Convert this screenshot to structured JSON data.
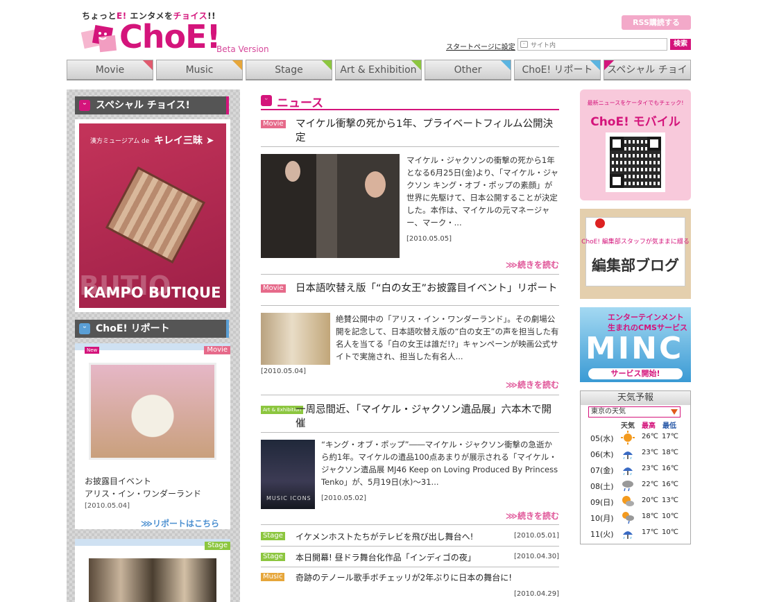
{
  "header": {
    "tagline_a": "ちょっと",
    "tagline_b": "E!",
    "tagline_c": " エンタメを",
    "tagline_d": "チョイス",
    "tagline_e": "!!",
    "logo": "ChoE!",
    "beta": "Beta Version",
    "rss_label": "RSS購読する",
    "startpage_link": "スタートページに設定",
    "search_placeholder": "サイト内",
    "search_button": "検索"
  },
  "nav": {
    "tabs": [
      {
        "label": "Movie",
        "color": "#e05a6e"
      },
      {
        "label": "Music",
        "color": "#e6a63a"
      },
      {
        "label": "Stage",
        "color": "#8cc63f"
      },
      {
        "label": "Art & Exhibition",
        "color": "#8cc63f"
      },
      {
        "label": "Other",
        "color": "#5ab4e0"
      },
      {
        "label": "ChoE! リポート",
        "color": "#5ab4e0"
      },
      {
        "label": "スペシャル チョイス!",
        "color": "#d4147b"
      }
    ]
  },
  "left": {
    "special_heading": "スペシャル チョイス!",
    "promo": {
      "subtitle": "漢方ミュージアム de",
      "title": "キレイ三昧 ➤",
      "bg_text": "BUTIQ",
      "name": "KAMPO BUTIQUE"
    },
    "report_heading": "ChoE! リポート",
    "report": {
      "tag_new": "New",
      "tag_category": "Movie",
      "line1": "お披露目イベント",
      "line2": "アリス・イン・ワンダーランド",
      "date": "[2010.05.04]",
      "link": "⋙リポートはこちら"
    },
    "stage_tag": "Stage"
  },
  "news": {
    "heading": "ニュース",
    "articles": [
      {
        "category": "Movie",
        "title": "マイケル衝撃の死から1年、プライベートフィルム公開決定",
        "body": "マイケル・ジャクソンの衝撃の死から1年となる6月25日(金)より、「マイケル・ジャクソン キング・オブ・ポップの素顔」が世界に先駆けて、日本公開することが決定した。本作は、マイケルの元マネージャー、マーク・...",
        "date": "[2010.05.05]",
        "more": "⋙続きを読む"
      },
      {
        "category": "Movie",
        "title": "日本語吹替え版「“白の女王”お披露目イベント」リポート",
        "body": "絶賛公開中の「アリス・イン・ワンダーランド」。その劇場公開を記念して、日本語吹替え版の“白の女王”の声を担当した有名人を当てる「白の女王は誰だ!?」キャンペーンが映画公式サイトで実施され、担当した有名人...",
        "date": "[2010.05.04]",
        "more": "⋙続きを読む"
      },
      {
        "category": "Art & Exhibition",
        "title": "一周忌間近、「マイケル・ジャクソン遺品展」六本木で開催",
        "body": "“キング・オブ・ポップ”――マイケル・ジャクソン衝撃の急逝から約1年。マイケルの遺品100点あまりが展示される「マイケル・ジャクソン遺品展 MJ46 Keep on Loving Produced By Princess Tenko」が、5月19日(水)〜31...",
        "date": "[2010.05.02]",
        "more": "⋙続きを読む",
        "photo_text": "MUSIC ICONS"
      }
    ],
    "short": [
      {
        "category": "Stage",
        "title": "イケメンホストたちがテレビを飛び出し舞台へ!",
        "date": "[2010.05.01]"
      },
      {
        "category": "Stage",
        "title": "本日開幕! 昼ドラ舞台化作品「インディゴの夜」",
        "date": "[2010.04.30]"
      },
      {
        "category": "Music",
        "title": "奇跡のテノール歌手ボチェッリが2年ぶりに日本の舞台に!",
        "date": "[2010.04.29]"
      }
    ]
  },
  "right": {
    "mobile_caption": "最新ニュースをケータイでもチェック!",
    "mobile_title": "ChoE! モバイル",
    "blog_caption": "ChoE! 編集部スタッフが気ままに綴る",
    "blog_title": "編集部ブログ",
    "minc_line1": "エンターテインメント",
    "minc_line2": "生まれのCMSサービス",
    "minc_title": "MINC",
    "minc_cta": "サービス開始!",
    "weather": {
      "heading": "天気予報",
      "location": "東京の天気",
      "col_weather": "天気",
      "col_high": "最高",
      "col_low": "最低",
      "days": [
        {
          "day": "05(水)",
          "icon": "sun-icon",
          "high": "26℃",
          "low": "17℃"
        },
        {
          "day": "06(木)",
          "icon": "rain-icon",
          "high": "23℃",
          "low": "18℃"
        },
        {
          "day": "07(金)",
          "icon": "rain-icon",
          "high": "23℃",
          "low": "16℃"
        },
        {
          "day": "08(土)",
          "icon": "cloud-rain-icon",
          "high": "22℃",
          "low": "16℃"
        },
        {
          "day": "09(日)",
          "icon": "sun-cloud-icon",
          "high": "20℃",
          "low": "13℃"
        },
        {
          "day": "10(月)",
          "icon": "sun-rain-icon",
          "high": "18℃",
          "low": "10℃"
        },
        {
          "day": "11(火)",
          "icon": "rain-icon",
          "high": "17℃",
          "low": "10℃"
        }
      ]
    }
  }
}
